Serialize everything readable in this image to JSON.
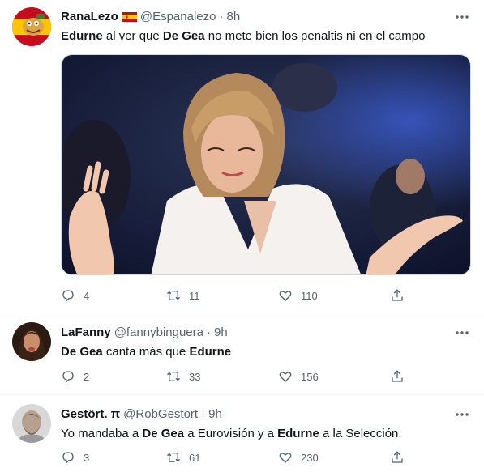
{
  "tweets": [
    {
      "name": "RanaLezo",
      "handle": "@Espanalezo",
      "dot": "·",
      "time": "8h",
      "text_parts": [
        "Edurne",
        " al ver que ",
        "De Gea",
        " no mete bien los penaltis ni en el campo"
      ],
      "replies": "4",
      "retweets": "11",
      "likes": "110"
    },
    {
      "name": "LaFanny",
      "handle": "@fannybinguera",
      "dot": "·",
      "time": "9h",
      "text_parts": [
        "De Gea",
        " canta más que ",
        "Edurne"
      ],
      "replies": "2",
      "retweets": "33",
      "likes": "156"
    },
    {
      "name": "Gestört. π",
      "handle": "@RobGestort",
      "dot": "·",
      "time": "9h",
      "text_parts": [
        "Yo mandaba a ",
        "De Gea",
        " a Eurovisión y a ",
        "Edurne",
        " a la Selección."
      ],
      "replies": "3",
      "retweets": "61",
      "likes": "230"
    }
  ],
  "colors": {
    "text": "#0f1419",
    "secondary": "#536471",
    "divider": "#eff3f4",
    "flag_red": "#c60b1e",
    "flag_yellow": "#ffc400"
  },
  "icons": [
    "reply-icon",
    "retweet-icon",
    "like-icon",
    "share-icon",
    "more-icon"
  ]
}
